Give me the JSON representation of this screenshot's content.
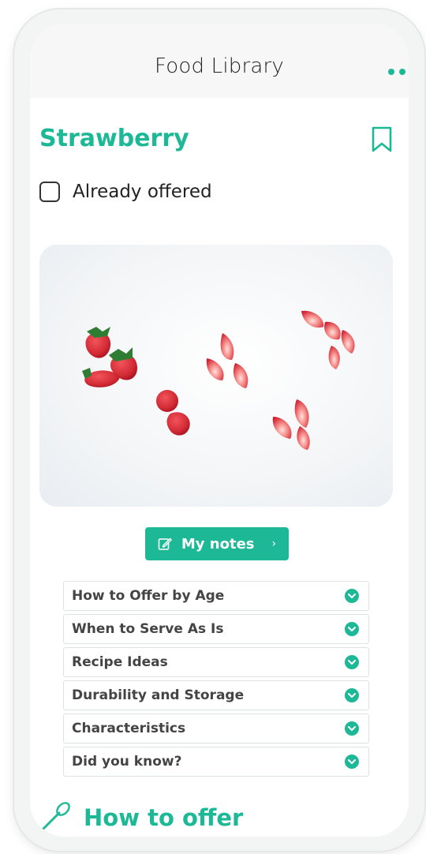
{
  "header": {
    "title": "Food Library"
  },
  "food": {
    "name": "Strawberry"
  },
  "offered": {
    "label": "Already offered",
    "checked": false
  },
  "notes_button": {
    "label": "My notes",
    "chevron": "›"
  },
  "sections": [
    {
      "label": "How to Offer by Age"
    },
    {
      "label": "When to Serve As Is"
    },
    {
      "label": "Recipe Ideas"
    },
    {
      "label": "Durability and Storage"
    },
    {
      "label": "Characteristics"
    },
    {
      "label": "Did you know?"
    }
  ],
  "how_to_offer": {
    "title": "How to offer"
  },
  "icons": {
    "more": "more-dots-icon",
    "bookmark": "bookmark-icon",
    "pen": "edit-icon",
    "chevron": "chevron-down-icon",
    "spoon": "spoon-icon"
  },
  "colors": {
    "accent": "#1db896",
    "text": "#222222"
  }
}
